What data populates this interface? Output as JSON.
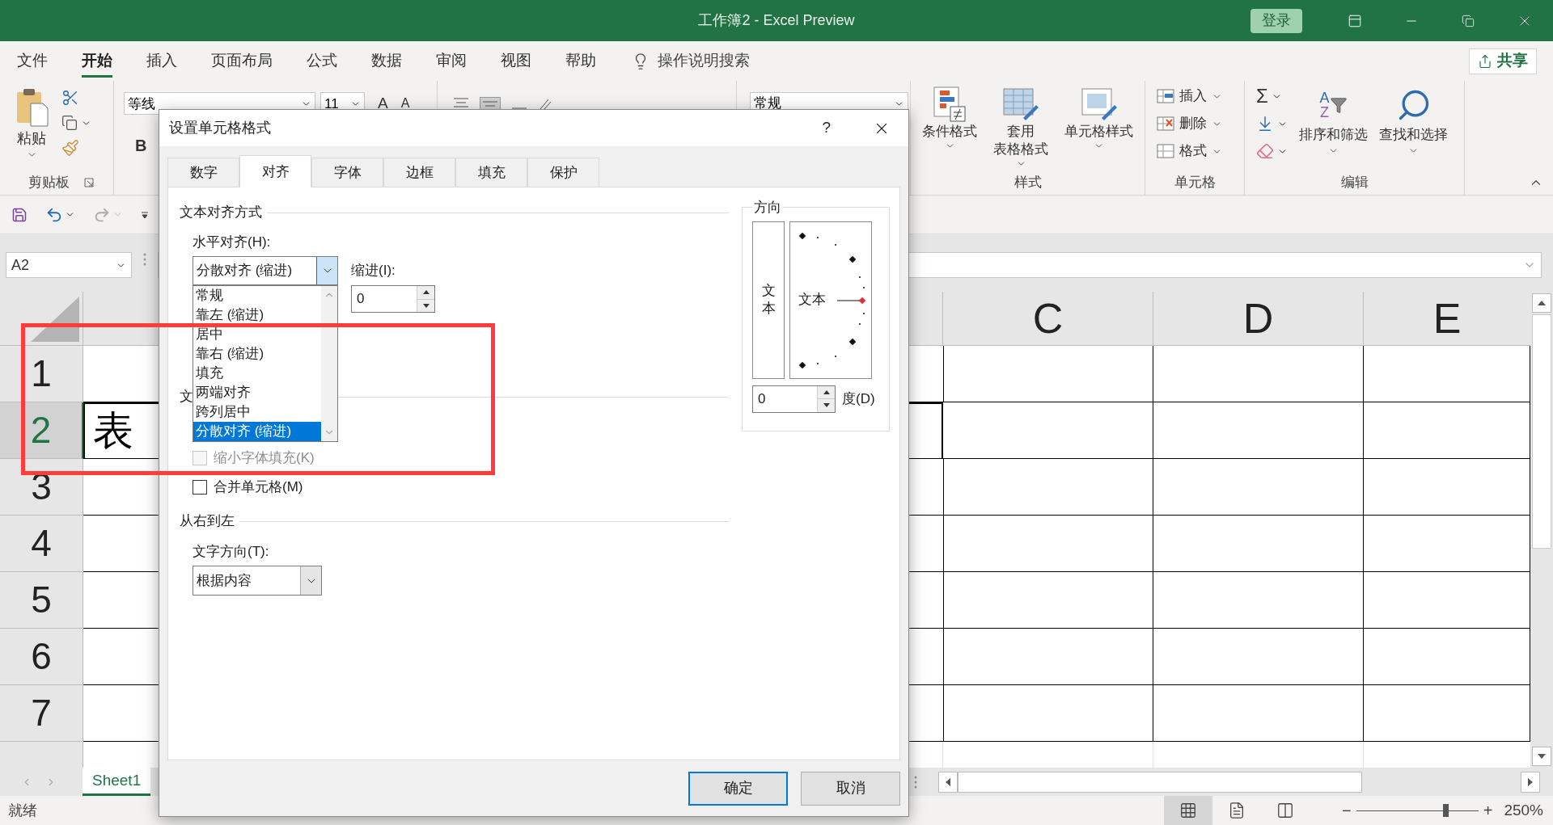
{
  "title_bar": {
    "title": "工作簿2  -  Excel Preview",
    "sign_in": "登录"
  },
  "menu_tabs": [
    {
      "label": "文件",
      "selected": false
    },
    {
      "label": "开始",
      "selected": true
    },
    {
      "label": "插入",
      "selected": false
    },
    {
      "label": "页面布局",
      "selected": false
    },
    {
      "label": "公式",
      "selected": false
    },
    {
      "label": "数据",
      "selected": false
    },
    {
      "label": "审阅",
      "selected": false
    },
    {
      "label": "视图",
      "selected": false
    },
    {
      "label": "帮助",
      "selected": false
    }
  ],
  "tell_me": "操作说明搜索",
  "share": "共享",
  "ribbon": {
    "clipboard": {
      "paste": "粘贴",
      "label": "剪贴板"
    },
    "font": {
      "name": "等线",
      "size": "11",
      "grow": "A",
      "shrink": "A",
      "bold": "B"
    },
    "number": {
      "format": "常规"
    },
    "styles": {
      "items": [
        {
          "kind": "conditional",
          "lines": [
            "条件格式"
          ]
        },
        {
          "kind": "table",
          "lines": [
            "套用",
            "表格格式"
          ]
        },
        {
          "kind": "cell",
          "lines": [
            "单元格样式"
          ]
        }
      ],
      "label": "样式"
    },
    "cells": {
      "items": [
        {
          "kind": "insert",
          "label": "插入"
        },
        {
          "kind": "delete",
          "label": "删除"
        },
        {
          "kind": "format",
          "label": "格式"
        }
      ],
      "label": "单元格"
    },
    "editing": {
      "sum": "Σ",
      "sort_letters": [
        "A",
        "Z"
      ],
      "sort": "排序和筛选",
      "find": "查找和选择",
      "label": "编辑"
    }
  },
  "name_box": "A2",
  "sheet": {
    "columns": [
      "C",
      "D",
      "E"
    ],
    "rows": [
      {
        "label": "1",
        "selected": false
      },
      {
        "label": "2",
        "selected": true
      },
      {
        "label": "3",
        "selected": false
      },
      {
        "label": "4",
        "selected": false
      },
      {
        "label": "5",
        "selected": false
      },
      {
        "label": "6",
        "selected": false
      },
      {
        "label": "7",
        "selected": false
      }
    ],
    "cell_a2": "表"
  },
  "sheet_tabs": [
    {
      "label": "Sheet1",
      "selected": true
    }
  ],
  "status_bar": {
    "status": "就绪",
    "views": [
      {
        "kind": "normal",
        "selected": true
      },
      {
        "kind": "page_layout",
        "selected": false
      },
      {
        "kind": "page_break",
        "selected": false
      }
    ],
    "zoom_out": "−",
    "zoom_in": "+",
    "zoom": {
      "level": 0.73,
      "reading": "250%"
    }
  },
  "dialog": {
    "title": "设置单元格格式",
    "help": "?",
    "tabs": [
      {
        "label": "数字",
        "selected": false
      },
      {
        "label": "对齐",
        "selected": true
      },
      {
        "label": "字体",
        "selected": false
      },
      {
        "label": "边框",
        "selected": false
      },
      {
        "label": "填充",
        "selected": false
      },
      {
        "label": "保护",
        "selected": false
      }
    ],
    "text_alignment": {
      "heading": "文本对齐方式",
      "horizontal_label": "水平对齐(H):",
      "horizontal_value": "分散对齐 (缩进)",
      "options": [
        {
          "label": "常规",
          "selected": false
        },
        {
          "label": "靠左 (缩进)",
          "selected": false
        },
        {
          "label": "居中",
          "selected": false
        },
        {
          "label": "靠右 (缩进)",
          "selected": false
        },
        {
          "label": "填充",
          "selected": false
        },
        {
          "label": "两端对齐",
          "selected": false
        },
        {
          "label": "跨列居中",
          "selected": false
        },
        {
          "label": "分散对齐 (缩进)",
          "selected": true
        }
      ],
      "indent_label": "缩进(I):",
      "indent_value": "0"
    },
    "text_control": {
      "heading": "文",
      "checkboxes": [
        {
          "label": "缩小字体填充(K)",
          "checked": false,
          "disabled": true
        },
        {
          "label": "合并单元格(M)",
          "checked": false,
          "disabled": false
        }
      ]
    },
    "right_to_left": {
      "heading": "从右到左",
      "direction_label": "文字方向(T):",
      "direction_value": "根据内容"
    },
    "orientation": {
      "heading": "方向",
      "vertical_text": "文本",
      "dial_text": "文本",
      "degrees": "0",
      "degrees_label": "度(D)"
    },
    "buttons": [
      {
        "label": "确定",
        "default": true
      },
      {
        "label": "取消",
        "default": false
      }
    ]
  },
  "annotation": {
    "kind": "highlight_box",
    "color": "#ff3b3b"
  }
}
